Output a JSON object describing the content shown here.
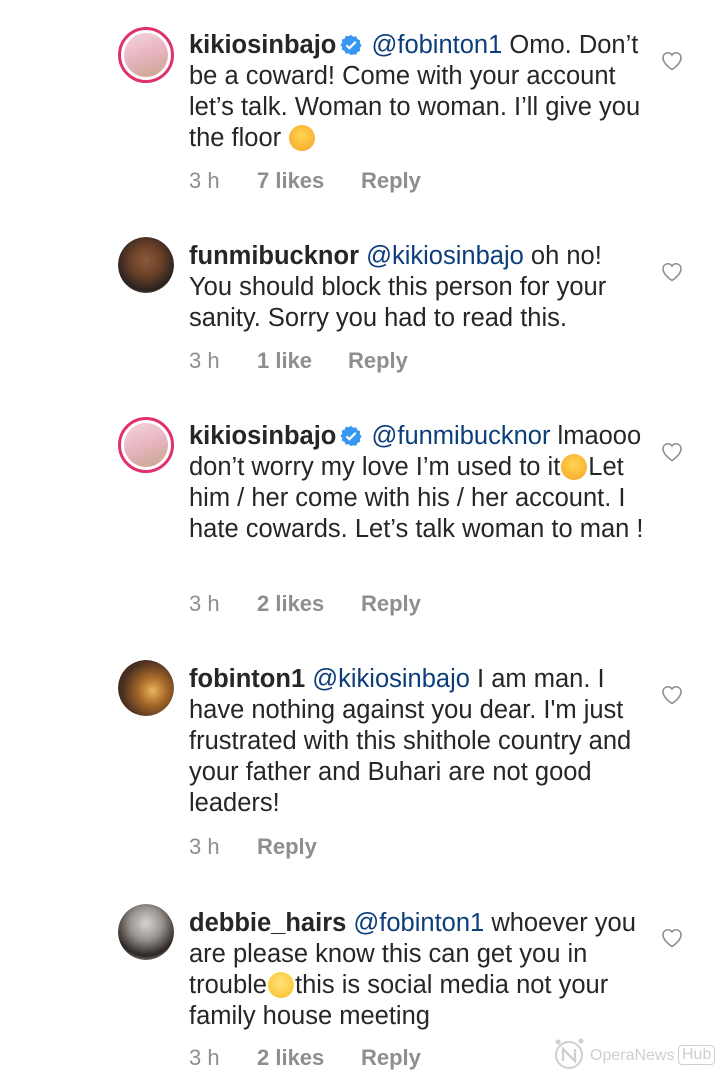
{
  "comments": [
    {
      "username": "kikiosinbajo",
      "verified": true,
      "mention": "@fobinton1",
      "text_line1_after": " Omo.",
      "text_rest": "Don’t be a coward! Come with your account let’s talk. Woman to woman. I’ll give you the floor",
      "emoji": "hugging-face",
      "time": "3 h",
      "likes": "7 likes",
      "reply": "Reply"
    },
    {
      "username": "funmibucknor",
      "verified": false,
      "mention": "@kikiosinbajo",
      "text_line1_after": " oh no!",
      "text_rest": "You should block this person for your sanity. Sorry you had to read this.",
      "time": "3 h",
      "likes": "1 like",
      "reply": "Reply"
    },
    {
      "username": "kikiosinbajo",
      "verified": true,
      "mention": "@funmibucknor",
      "text_part1": "lmaooo don’t worry my love I’m used to it",
      "emoji": "face-savoring-food",
      "text_part2": "Let him / her come with his / her account. I hate cowards. Let’s talk woman to man !",
      "time": "3 h",
      "likes": "2 likes",
      "reply": "Reply"
    },
    {
      "username": "fobinton1",
      "verified": false,
      "mention": "@kikiosinbajo",
      "text_line1_after": " I am man.",
      "text_rest": "I have nothing against you dear. I'm just frustrated with this shithole country and your father and Buhari are not good leaders!",
      "time": "3 h",
      "reply": "Reply"
    },
    {
      "username": "debbie_hairs",
      "verified": false,
      "mention": "@fobinton1",
      "text_part1": "whoever you are please know this can get you in trouble",
      "emoji": "pleading-face",
      "text_part2": "this is social media not your family house meeting",
      "time": "3 h",
      "likes": "2 likes",
      "reply": "Reply"
    }
  ],
  "watermark": {
    "text": "OperaNews",
    "badge": "Hub"
  },
  "colors": {
    "mention": "#0b3e7a",
    "meta": "#8e8e8e",
    "verified": "#3897f0",
    "story_ring": "#e1306c"
  }
}
